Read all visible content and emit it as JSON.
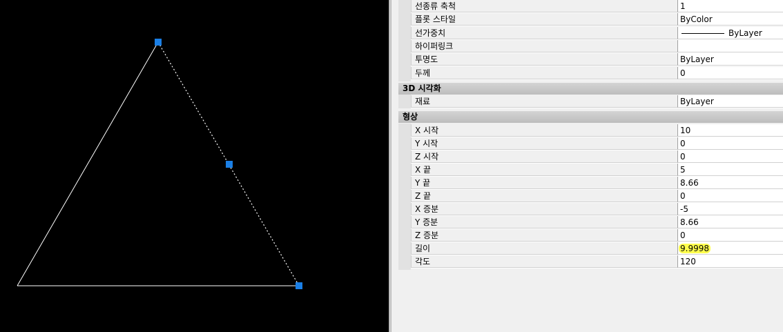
{
  "panel": {
    "general_rows": [
      {
        "label": "선종류 축척",
        "value": "1"
      },
      {
        "label": "플롯 스타일",
        "value": "ByColor"
      },
      {
        "label": "선가중치",
        "value": "ByLayer",
        "swatch": true
      },
      {
        "label": "하이퍼링크",
        "value": ""
      },
      {
        "label": "투명도",
        "value": "ByLayer"
      },
      {
        "label": "두께",
        "value": "0"
      }
    ],
    "viz_header": "3D 시각화",
    "viz_rows": [
      {
        "label": "재료",
        "value": "ByLayer"
      }
    ],
    "geo_header": "형상",
    "geo_rows": [
      {
        "label": "X 시작",
        "value": "10"
      },
      {
        "label": "Y 시작",
        "value": "0"
      },
      {
        "label": "Z 시작",
        "value": "0"
      },
      {
        "label": "X 끝",
        "value": "5"
      },
      {
        "label": "Y 끝",
        "value": "8.66"
      },
      {
        "label": "Z 끝",
        "value": "0"
      },
      {
        "label": "X 증분",
        "value": "-5"
      },
      {
        "label": "Y 증분",
        "value": "8.66"
      },
      {
        "label": "Z 증분",
        "value": "0"
      },
      {
        "label": "길이",
        "value": "9.9998",
        "highlight": true
      },
      {
        "label": "각도",
        "value": "120"
      }
    ]
  },
  "colors": {
    "canvas_bg": "#000000",
    "line": "#ffffff",
    "grip": "#1a7fe6",
    "highlight": "#ffff4d"
  }
}
